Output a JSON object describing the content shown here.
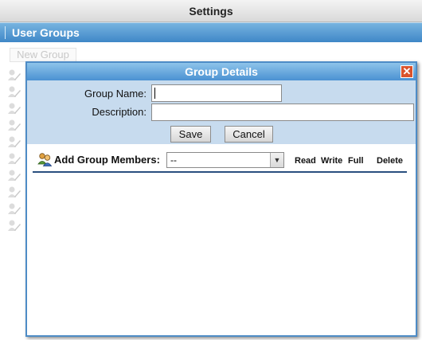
{
  "header": {
    "title": "Settings"
  },
  "section": {
    "title": "User Groups"
  },
  "toolbar": {
    "new_group_label": "New Group"
  },
  "background_rows": {
    "count_icons": 10,
    "icon": "user-pencil-icon"
  },
  "dialog": {
    "title": "Group Details",
    "close_icon": "close-icon",
    "group_name_label": "Group Name:",
    "group_name_value": "",
    "description_label": "Description:",
    "description_value": "",
    "save_label": "Save",
    "cancel_label": "Cancel",
    "members_icon": "users-icon",
    "add_members_label": "Add Group Members:",
    "members_select_value": "--",
    "columns": {
      "read": "Read",
      "write": "Write",
      "full": "Full",
      "delete": "Delete"
    }
  },
  "colors": {
    "header_blue": "#3f87c7",
    "close_button": "#d9532c",
    "form_background": "#c7dbee"
  }
}
